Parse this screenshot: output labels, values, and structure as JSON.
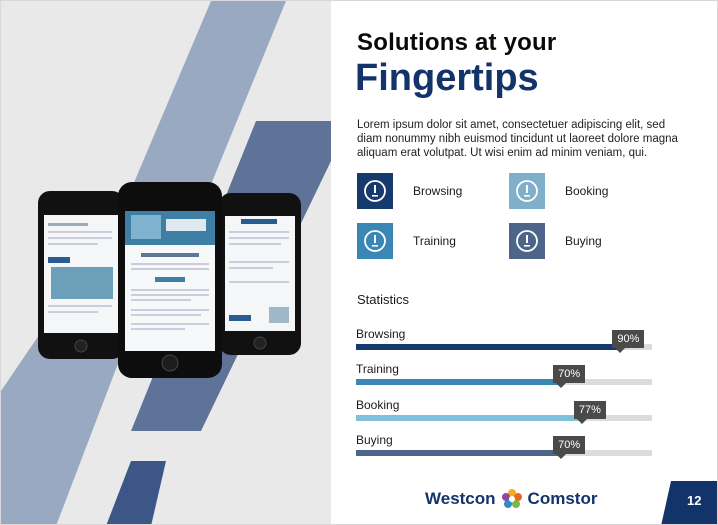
{
  "slide": {
    "heading_line1": "Solutions at your",
    "heading_line2": "Fingertips",
    "intro": "Lorem ipsum dolor sit amet, consectetuer adipiscing elit, sed diam nonummy nibh euismod tincidunt ut laoreet dolore magna aliquam erat volutpat. Ut wisi enim ad minim veniam, qui."
  },
  "features": [
    {
      "label": "Browsing",
      "color": "#173a6e",
      "icon": "info-icon"
    },
    {
      "label": "Booking",
      "color": "#7fafc9",
      "icon": "info-icon"
    },
    {
      "label": "Training",
      "color": "#3a86b4",
      "icon": "info-icon"
    },
    {
      "label": "Buying",
      "color": "#4d6588",
      "icon": "info-icon"
    }
  ],
  "stats": {
    "title": "Statistics",
    "items": [
      {
        "label": "Browsing",
        "value": "90%",
        "fraction": 0.9,
        "color": "#173a6e"
      },
      {
        "label": "Training",
        "value": "70%",
        "fraction": 0.7,
        "color": "#3a86b4"
      },
      {
        "label": "Booking",
        "value": "77%",
        "fraction": 0.77,
        "color": "#7fc0dc"
      },
      {
        "label": "Buying",
        "value": "70%",
        "fraction": 0.7,
        "color": "#4d6588"
      }
    ]
  },
  "footer": {
    "logo_left": "Westcon",
    "logo_right": "Comstor",
    "page_number": "12"
  },
  "phones": {
    "center_screen_title": "Welcome to Westcon"
  },
  "colors": {
    "navy": "#13336b",
    "band_light": "#9aa9c2",
    "band_dark": "#5f7398"
  }
}
